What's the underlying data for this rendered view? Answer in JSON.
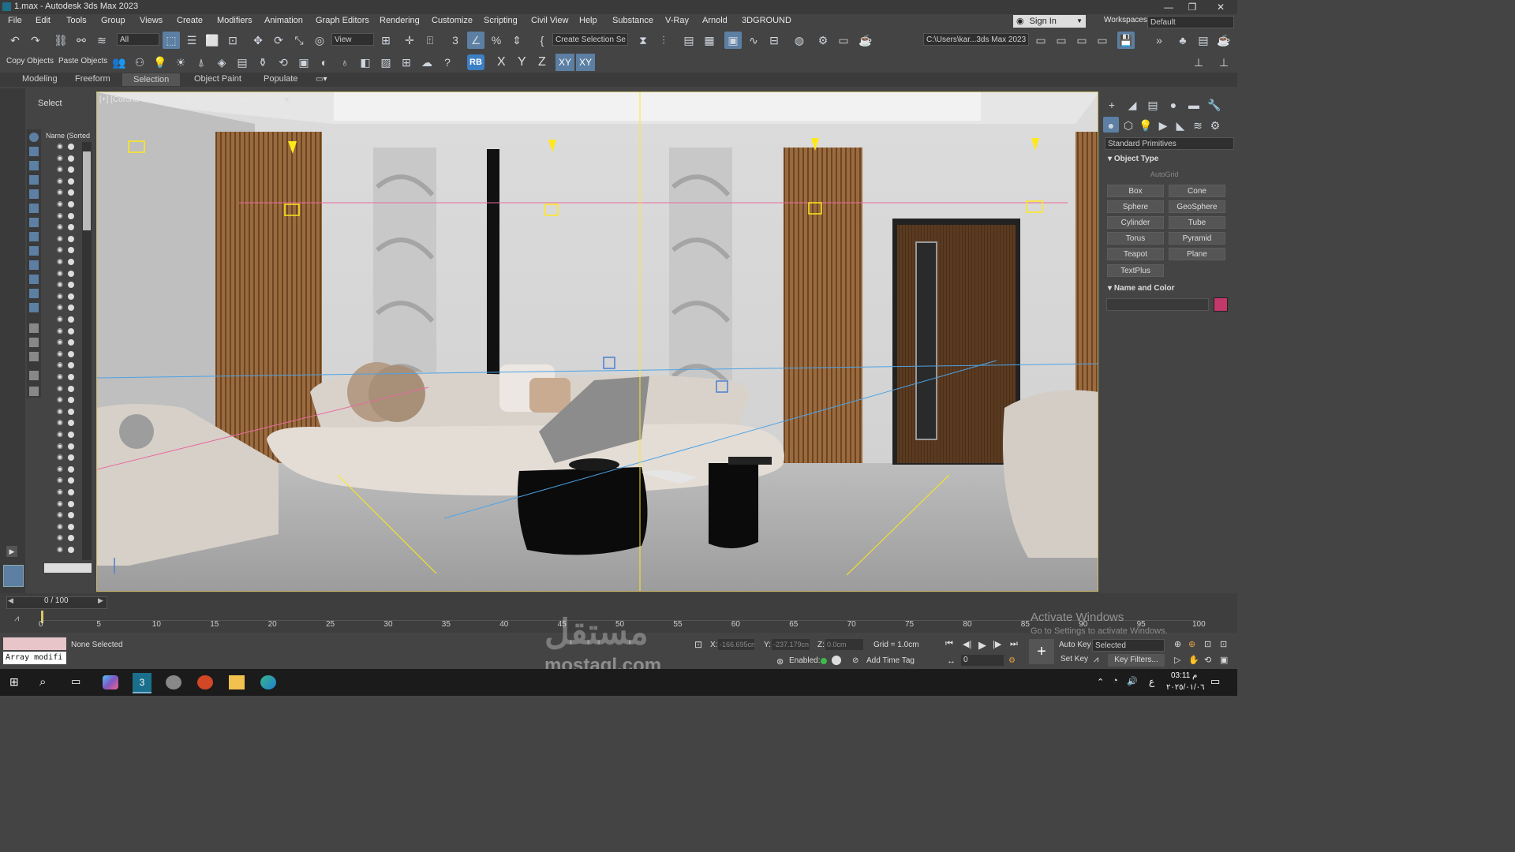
{
  "window": {
    "title": "1.max - Autodesk 3ds Max 2023",
    "minimize": "—",
    "maximize": "❐",
    "close": "✕"
  },
  "menu": [
    "File",
    "Edit",
    "Tools",
    "Group",
    "Views",
    "Create",
    "Modifiers",
    "Animation",
    "Graph Editors",
    "Rendering",
    "Customize",
    "Scripting",
    "Civil View",
    "Help",
    "Substance",
    "V-Ray",
    "Arnold",
    "3DGROUND"
  ],
  "account": {
    "sign_in": "Sign In",
    "workspaces_label": "Workspaces:",
    "workspace": "Default"
  },
  "toolbar": {
    "selection_filter": "All",
    "ref_coord": "View",
    "selection_set": "Create Selection Se",
    "project_path": "C:\\Users\\kar...3ds Max 2023"
  },
  "toolbar2": {
    "copy_objects": "Copy Objects",
    "paste_objects": "Paste Objects",
    "rb": "RB",
    "x": "X",
    "y": "Y",
    "z": "Z",
    "xy": "XY",
    "xy2": "XY"
  },
  "ribbon": {
    "tabs": [
      "Modeling",
      "Freeform",
      "Selection",
      "Object Paint",
      "Populate"
    ],
    "active": "Selection"
  },
  "explorer": {
    "select_label": "Select",
    "column_header": "Name (Sorted A"
  },
  "viewport": {
    "label": "[+] [Corona Camera001] [Standard] [Default Shading]"
  },
  "command_panel": {
    "category": "Standard Primitives",
    "object_type_header": "Object Type",
    "autogrid": "AutoGrid",
    "buttons": [
      "Box",
      "Cone",
      "Sphere",
      "GeoSphere",
      "Cylinder",
      "Tube",
      "Torus",
      "Pyramid",
      "Teapot",
      "Plane",
      "TextPlus"
    ],
    "name_color_header": "Name and Color",
    "object_color": "#c2386a"
  },
  "timeline": {
    "frame_counter": "0 / 100",
    "ticks": [
      "0",
      "5",
      "10",
      "15",
      "20",
      "25",
      "30",
      "35",
      "40",
      "45",
      "50",
      "55",
      "60",
      "65",
      "70",
      "75",
      "80",
      "85",
      "90",
      "95",
      "100"
    ]
  },
  "status": {
    "modifier_field": "Array modifi",
    "selection_status": "None Selected",
    "x_label": "X:",
    "x_value": "-166.695cn",
    "y_label": "Y:",
    "y_value": "-237.179cn",
    "z_label": "Z:",
    "z_value": "0.0cm",
    "grid": "Grid = 1.0cm",
    "enabled": "Enabled:",
    "add_time_tag": "Add Time Tag",
    "auto_key": "Auto Key",
    "set_key": "Set Key",
    "key_mode": "Selected",
    "key_filters": "Key Filters...",
    "frame_field": "0"
  },
  "watermark": {
    "activate_title": "Activate Windows",
    "activate_sub": "Go to Settings to activate Windows.",
    "site_text": "mostaql.com"
  },
  "taskbar": {
    "time": "03:11 م",
    "date": "٢٠٢٥/٠١/٠٦",
    "lang": "ع"
  },
  "colors": {
    "accent": "#5c7fa3",
    "viewport_border": "#c9b86a",
    "light_yellow": "#ffe81a"
  }
}
